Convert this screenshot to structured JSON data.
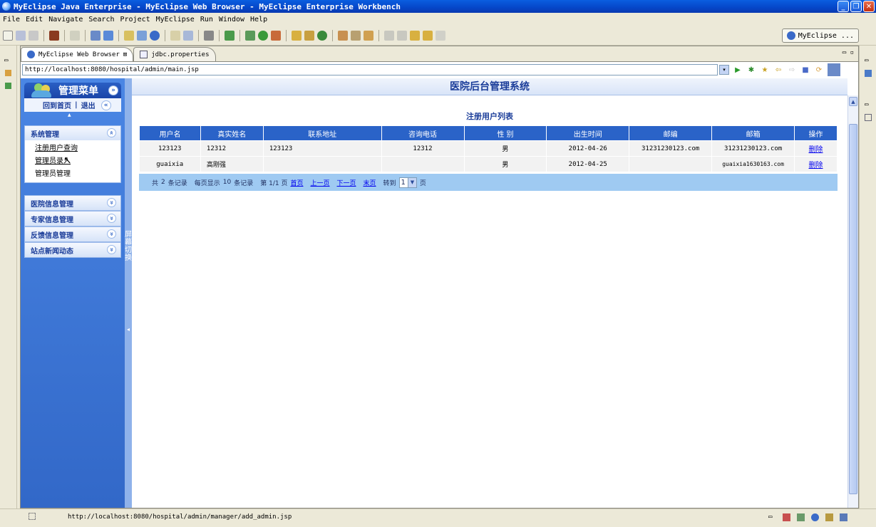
{
  "window": {
    "title": "MyEclipse Java Enterprise - MyEclipse Web Browser - MyEclipse Enterprise Workbench",
    "buttons": [
      "_",
      "❐",
      "✕"
    ]
  },
  "menubar": [
    "File",
    "Edit",
    "Navigate",
    "Search",
    "Project",
    "MyEclipse",
    "Run",
    "Window",
    "Help"
  ],
  "perspective": {
    "label": "MyEclipse ..."
  },
  "editor_tabs": [
    {
      "label": "MyEclipse Web Browser",
      "close": "⊠"
    },
    {
      "label": "jdbc.properties"
    }
  ],
  "browser": {
    "url": "http://localhost:8080/hospital/admin/main.jsp"
  },
  "sidebar": {
    "title": "管理菜单",
    "home_label": "回到首页",
    "divider": "|",
    "logout_label": "退出",
    "collapse_arrow": "«",
    "expand_arrow": "»",
    "up_arrow": "▲",
    "groups": [
      {
        "label": "系统管理",
        "items": [
          "注册用户查询",
          "管理员录入",
          "管理员管理"
        ]
      },
      {
        "label": "医院信息管理"
      },
      {
        "label": "专家信息管理"
      },
      {
        "label": "反馈信息管理"
      },
      {
        "label": "站点新闻动态"
      }
    ],
    "switch_label": "屏幕切换",
    "switch_arrow": "◂"
  },
  "page": {
    "title": "医院后台管理系统",
    "list_title": "注册用户列表",
    "table": {
      "headers": [
        "用户名",
        "真实姓名",
        "联系地址",
        "咨询电话",
        "性 别",
        "出生时间",
        "邮编",
        "邮箱",
        "操作"
      ],
      "rows": [
        [
          "123123",
          "12312",
          "123123",
          "12312",
          "男",
          "2012-04-26",
          "31231230123.com",
          "31231230123.com",
          "删除"
        ],
        [
          "guaixia",
          "高刚强",
          "",
          "",
          "男",
          "2012-04-25",
          "",
          "guaixia1630163.com",
          "删除"
        ]
      ]
    },
    "pager": {
      "total_prefix": "共",
      "total": "2",
      "total_suffix": "条记录",
      "per_page_prefix": "每页显示",
      "per_page": "10",
      "per_page_suffix": "条记录",
      "page_info": "第 1/1 页",
      "first": "首页",
      "prev": "上一页",
      "next": "下一页",
      "last": "末页",
      "goto_label": "转到",
      "goto_value": "1",
      "goto_suffix": "页"
    }
  },
  "statusbar": {
    "url": "http://localhost:8080/hospital/admin/manager/add_admin.jsp"
  }
}
